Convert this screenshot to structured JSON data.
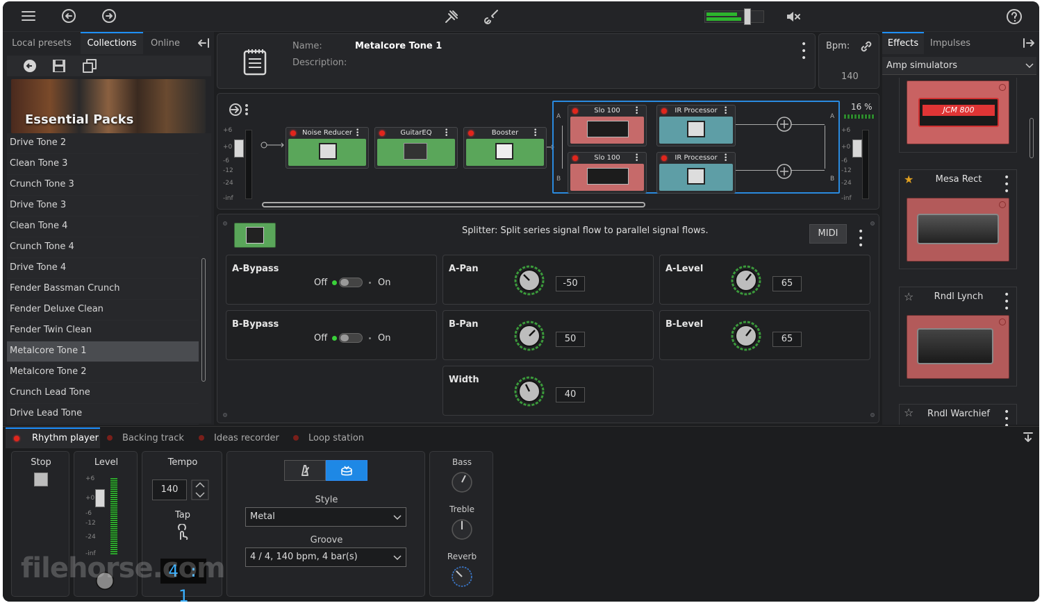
{
  "topbar": {
    "icons": [
      "menu-icon",
      "undo-icon",
      "redo-icon",
      "tuner-icon",
      "guitar-icon",
      "volume-meter",
      "mute-icon",
      "help-icon"
    ]
  },
  "left": {
    "tabs": [
      "Local presets",
      "Collections",
      "Online"
    ],
    "active_tab": "Collections",
    "banner": "Essential Packs",
    "presets": [
      "Drive Tone 2",
      "Clean Tone 3",
      "Crunch Tone 3",
      "Drive Tone 3",
      "Clean Tone 4",
      "Crunch Tone 4",
      "Drive Tone 4",
      "Fender Bassman Crunch",
      "Fender Deluxe Clean",
      "Fender Twin Clean",
      "Metalcore Tone 1",
      "Metalcore Tone 2",
      "Crunch Lead Tone",
      "Drive Lead Tone"
    ],
    "selected": "Metalcore Tone 1"
  },
  "preset": {
    "name_label": "Name:",
    "name": "Metalcore Tone 1",
    "desc_label": "Description:",
    "bpm_label": "Bpm:",
    "bpm": "140"
  },
  "chain": {
    "meter_labels": [
      "+6",
      "+0",
      "-6",
      "-12",
      "-24",
      "-inf"
    ],
    "pedals": [
      "Noise Reducer",
      "GuitarEQ",
      "Booster"
    ],
    "lane_a": [
      "Slo 100",
      "IR Processor"
    ],
    "lane_b": [
      "Slo 100",
      "IR Processor"
    ],
    "lane_a_label": "A",
    "lane_b_label": "B",
    "cpu": "16 %"
  },
  "detail": {
    "description": "Splitter:  Split series signal flow to parallel signal flows.",
    "midi": "MIDI",
    "a_bypass": {
      "label": "A-Bypass",
      "off": "Off",
      "on": "On"
    },
    "b_bypass": {
      "label": "B-Bypass",
      "off": "Off",
      "on": "On"
    },
    "a_pan": {
      "label": "A-Pan",
      "value": "-50"
    },
    "a_level": {
      "label": "A-Level",
      "value": "65"
    },
    "b_pan": {
      "label": "B-Pan",
      "value": "50"
    },
    "b_level": {
      "label": "B-Level",
      "value": "65"
    },
    "width": {
      "label": "Width",
      "value": "40"
    }
  },
  "right": {
    "tabs": [
      "Effects",
      "Impulses"
    ],
    "active_tab": "Effects",
    "category": "Amp simulators",
    "amps": [
      {
        "name": "",
        "logo": "JCM 800",
        "star": false
      },
      {
        "name": "Mesa Rect",
        "star": true
      },
      {
        "name": "Rndl Lynch",
        "star": false
      },
      {
        "name": "Rndl Warchief",
        "star": false
      }
    ]
  },
  "bottom": {
    "tabs": [
      "Rhythm player",
      "Backing track",
      "Ideas recorder",
      "Loop station"
    ],
    "stop": "Stop",
    "level": "Level",
    "level_labels": [
      "+6",
      "+0",
      "-6",
      "-12",
      "-24",
      "-inf"
    ],
    "tempo": "Tempo",
    "tempo_value": "140",
    "tap": "Tap",
    "style_label": "Style",
    "style_value": "Metal",
    "groove_label": "Groove",
    "groove_value": "4 / 4,  140  bpm,  4 bar(s)",
    "bass": "Bass",
    "treble": "Treble",
    "reverb": "Reverb",
    "lcd": "4 : 1",
    "watermark": "filehorse.com"
  }
}
